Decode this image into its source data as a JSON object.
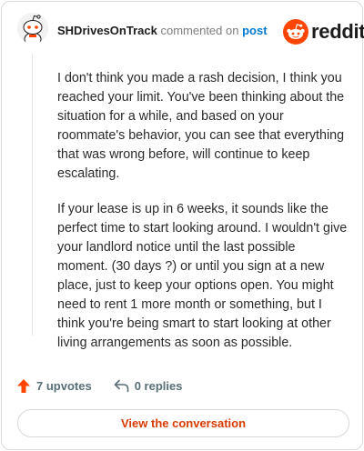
{
  "header": {
    "author": "SHDrivesOnTrack",
    "action_text": "commented on",
    "post_link": "post",
    "logo_text": "reddit",
    "logo_icon": "reddit-alien-icon",
    "avatar_icon": "snoo-avatar-icon"
  },
  "comment": {
    "paragraphs": [
      "I don't think you made a rash decision, I think you reached your limit. You've been thinking about the situation for a while, and based on your roommate's behavior, you can see that everything that was wrong before, will continue to keep escalating.",
      "If your lease is up in 6 weeks, it sounds like the perfect time to start looking around. I wouldn't give your landlord notice until the last possible moment. (30 days ?) or until you sign at a new place, just to keep your options open. You might need to rent 1 more month or something, but I think you're being smart to start looking at other living arrangements as soon as possible."
    ]
  },
  "actions": {
    "upvotes": "7 upvotes",
    "replies": "0 replies",
    "upvote_icon": "upvote-arrow-icon",
    "reply_icon": "reply-arrow-icon"
  },
  "cta": {
    "label": "View the conversation"
  },
  "colors": {
    "brand": "#ff4500",
    "cta_text": "#d93a00",
    "link": "#0079d3",
    "meta": "#576f76"
  }
}
